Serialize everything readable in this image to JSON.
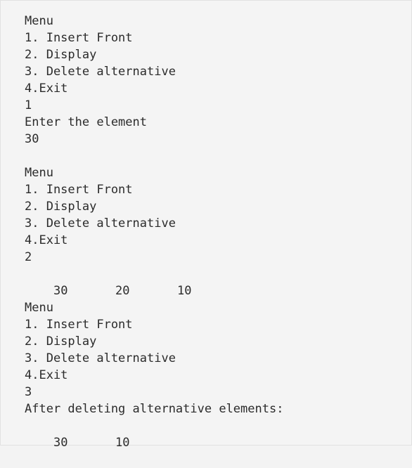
{
  "console": {
    "block1": {
      "menu_title": "Menu",
      "options": [
        "1. Insert Front",
        "2. Display",
        "3. Delete alternative",
        "4.Exit"
      ],
      "choice": "1",
      "prompt": "Enter the element",
      "input": "30"
    },
    "block2": {
      "menu_title": "Menu",
      "options": [
        "1. Insert Front",
        "2. Display",
        "3. Delete alternative",
        "4.Exit"
      ],
      "choice": "2",
      "values": [
        "30",
        "20",
        "10"
      ]
    },
    "block3": {
      "menu_title": "Menu",
      "options": [
        "1. Insert Front",
        "2. Display",
        "3. Delete alternative",
        "4.Exit"
      ],
      "choice": "3",
      "message": "After deleting alternative elements:",
      "values": [
        "30",
        "10"
      ]
    }
  }
}
